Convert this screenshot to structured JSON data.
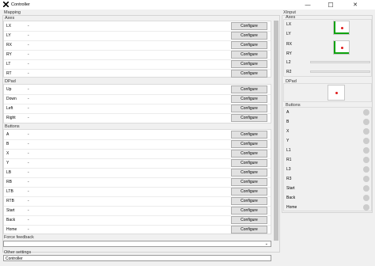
{
  "window": {
    "title": "Controller",
    "min_glyph": "—",
    "max_glyph": "☐",
    "close_glyph": "✕"
  },
  "mapping": {
    "title": "Mapping",
    "axes": {
      "title": "Axes",
      "rows": [
        {
          "label": "LX",
          "value": "-"
        },
        {
          "label": "LY",
          "value": "-"
        },
        {
          "label": "RX",
          "value": "-"
        },
        {
          "label": "RY",
          "value": "-"
        },
        {
          "label": "LT",
          "value": "-"
        },
        {
          "label": "RT",
          "value": "-"
        }
      ]
    },
    "dpad": {
      "title": "DPad",
      "rows": [
        {
          "label": "Up",
          "value": "-"
        },
        {
          "label": "Down",
          "value": "-"
        },
        {
          "label": "Left",
          "value": "-"
        },
        {
          "label": "Right",
          "value": "-"
        }
      ]
    },
    "buttons": {
      "title": "Buttons",
      "rows": [
        {
          "label": "A",
          "value": "-"
        },
        {
          "label": "B",
          "value": "-"
        },
        {
          "label": "X",
          "value": "-"
        },
        {
          "label": "Y",
          "value": "-"
        },
        {
          "label": "LB",
          "value": "-"
        },
        {
          "label": "RB",
          "value": "-"
        },
        {
          "label": "LTB",
          "value": "-"
        },
        {
          "label": "RTB",
          "value": "-"
        },
        {
          "label": "Start",
          "value": "-"
        },
        {
          "label": "Back",
          "value": "-"
        },
        {
          "label": "Home",
          "value": "-"
        }
      ]
    },
    "configure_label": "Configure",
    "force_feedback": {
      "title": "Force feedback",
      "value": ""
    },
    "other_settings": {
      "title": "Other settings",
      "value": "Controller"
    }
  },
  "xinput": {
    "title": "XInput",
    "axes": {
      "title": "Axes",
      "labels": [
        "LX",
        "LY",
        "RX",
        "RY",
        "L2",
        "R2"
      ],
      "L2_level": 0,
      "R2_level": 0
    },
    "dpad": {
      "title": "DPad"
    },
    "buttons": {
      "title": "Buttons",
      "labels": [
        "A",
        "B",
        "X",
        "Y",
        "L1",
        "R1",
        "L3",
        "R3",
        "Start",
        "Back",
        "Home"
      ]
    }
  },
  "colors": {
    "accent_green": "#0fa30f",
    "dot_red": "#e01b1b",
    "indicator_off": "#cccccc"
  }
}
